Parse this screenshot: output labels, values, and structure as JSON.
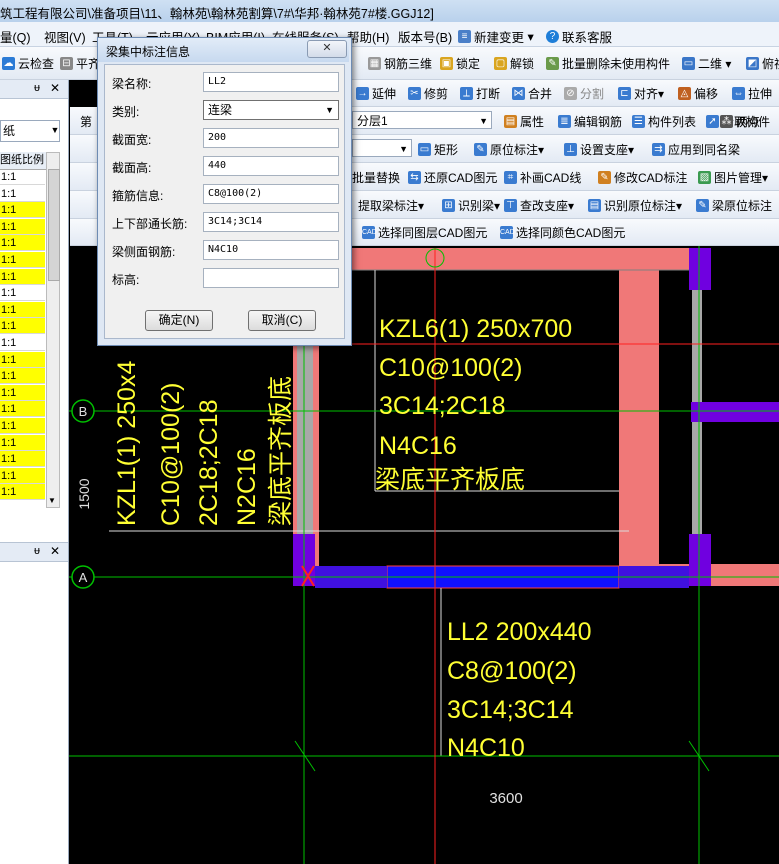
{
  "window": {
    "title": "筑工程有限公司\\准备项目\\11、翰林苑\\翰林苑割算\\7#\\华邦·翰林苑7#楼.GGJ12]"
  },
  "menu": [
    "量(Q)",
    "视图(V)",
    "工具(T)",
    "云应用(Y)",
    "BIM应用(I)",
    "在线服务(S)",
    "帮助(H)",
    "版本号(B)",
    "新建变更",
    "联系客服"
  ],
  "toolbar1": {
    "items": [
      "云检查",
      "平齐",
      "钢筋三维",
      "锁定",
      "解锁",
      "批量删除未使用构件",
      "二维",
      "俯视"
    ]
  },
  "toolbar2": {
    "items": [
      "延伸",
      "修剪",
      "打断",
      "合并",
      "分割",
      "对齐",
      "偏移",
      "拉伸"
    ]
  },
  "toolbar3": {
    "prefix": "第",
    "layer_value": "分层1",
    "items": [
      "属性",
      "编辑钢筋",
      "构件列表",
      "拾取构件",
      "两点"
    ]
  },
  "toolbar4": {
    "items": [
      "矩形",
      "原位标注",
      "设置支座",
      "应用到同名梁"
    ]
  },
  "toolbar5": {
    "items": [
      "批量替换",
      "还原CAD图元",
      "补画CAD线",
      "修改CAD标注",
      "图片管理"
    ]
  },
  "toolbar6": {
    "items": [
      "提取梁标注",
      "识别梁",
      "查改支座",
      "识别原位标注",
      "梁原位标注"
    ]
  },
  "toolbar7": {
    "items": [
      "选择同图层CAD图元",
      "选择同颜色CAD图元"
    ]
  },
  "left_panel": {
    "header": "图纸比例",
    "tab_label": "纸",
    "rows": [
      "1:1",
      "1:1",
      "1:1",
      "1:1",
      "1:1",
      "1:1",
      "1:1",
      "1:1",
      "1:1",
      "1:1",
      "1:1",
      "1:1",
      "1:1",
      "1:1",
      "1:1",
      "1:1",
      "1:1",
      "1:1",
      "1:1",
      "1:1"
    ],
    "highlight_color": "#ffff00"
  },
  "dialog": {
    "title": "梁集中标注信息",
    "fields": [
      {
        "label": "梁名称:",
        "value": "LL2"
      },
      {
        "label": "类别:",
        "value": "连梁"
      },
      {
        "label": "截面宽:",
        "value": "200"
      },
      {
        "label": "截面高:",
        "value": "440"
      },
      {
        "label": "箍筋信息:",
        "value": "C8@100(2)"
      },
      {
        "label": "上下部通长筋:",
        "value": "3C14;3C14"
      },
      {
        "label": "梁侧面钢筋:",
        "value": "N4C10"
      },
      {
        "label": "标高:",
        "value": ""
      }
    ],
    "ok_label": "确定(N)",
    "cancel_label": "取消(C)"
  },
  "cad": {
    "axis_labels": [
      "B",
      "A"
    ],
    "dimension_vertical": "1500",
    "dimension_horizontal": "3600",
    "annotation_kzl6": [
      "KZL6(1) 250x700",
      "C10@100(2)",
      "3C14;2C18",
      "N4C16",
      "梁底平齐板底"
    ],
    "annotation_kzl1": [
      "KZL1(1) 250x4",
      "C10@100(2)",
      "2C18;2C18",
      "N2C16",
      "梁底平齐板底"
    ],
    "annotation_ll2": [
      "LL2 200x440",
      "C8@100(2)",
      "3C14;3C14",
      "N4C10"
    ],
    "colors": {
      "text": "#ffff33",
      "beam": "#f07878",
      "selected": "#1010ff",
      "axis": "#00c000",
      "column": "#9000c0"
    }
  }
}
